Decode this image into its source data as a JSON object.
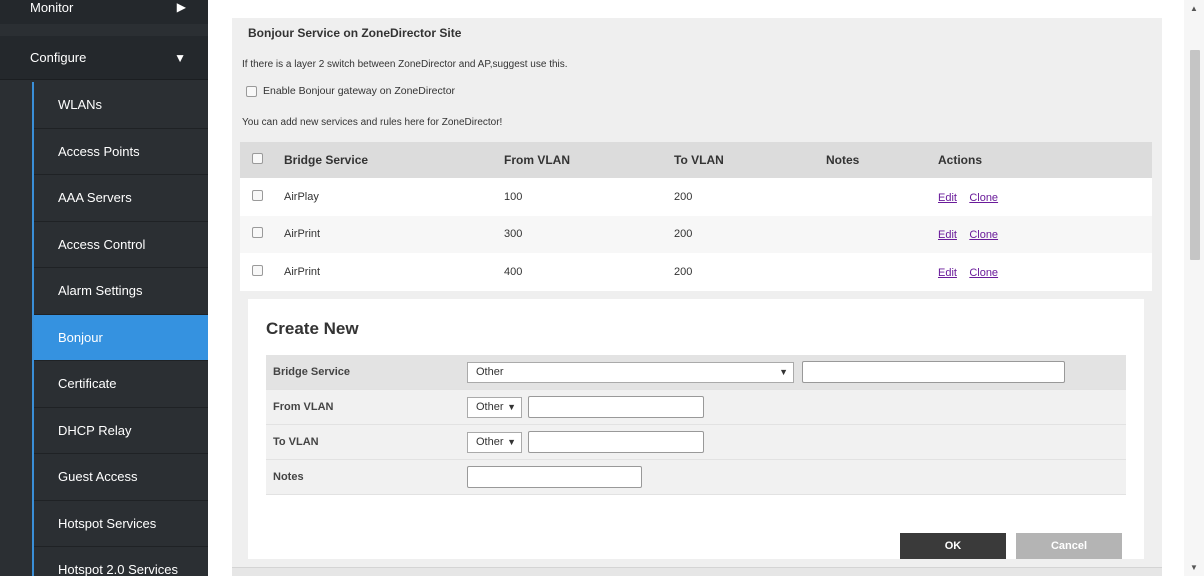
{
  "sidebar": {
    "monitor_label": "Monitor",
    "configure_label": "Configure",
    "items": [
      {
        "label": "WLANs"
      },
      {
        "label": "Access Points"
      },
      {
        "label": "AAA Servers"
      },
      {
        "label": "Access Control"
      },
      {
        "label": "Alarm Settings"
      },
      {
        "label": "Bonjour"
      },
      {
        "label": "Certificate"
      },
      {
        "label": "DHCP Relay"
      },
      {
        "label": "Guest Access"
      },
      {
        "label": "Hotspot Services"
      },
      {
        "label": "Hotspot 2.0 Services"
      }
    ],
    "active_item": "Bonjour"
  },
  "main": {
    "section_title": "Bonjour Service on ZoneDirector Site",
    "info_text": "If there is a layer 2 switch between ZoneDirector and AP,suggest use this.",
    "gateway_label": "Enable Bonjour gateway on ZoneDirector",
    "add_text": "You can add new services and rules here for ZoneDirector!",
    "table": {
      "headers": {
        "bridge_service": "Bridge Service",
        "from_vlan": "From VLAN",
        "to_vlan": "To VLAN",
        "notes": "Notes",
        "actions": "Actions"
      },
      "rows": [
        {
          "bridge_service": "AirPlay",
          "from_vlan": "100",
          "to_vlan": "200",
          "notes": "",
          "edit": "Edit",
          "clone": "Clone"
        },
        {
          "bridge_service": "AirPrint",
          "from_vlan": "300",
          "to_vlan": "200",
          "notes": "",
          "edit": "Edit",
          "clone": "Clone"
        },
        {
          "bridge_service": "AirPrint",
          "from_vlan": "400",
          "to_vlan": "200",
          "notes": "",
          "edit": "Edit",
          "clone": "Clone"
        }
      ]
    }
  },
  "create_new": {
    "title": "Create New",
    "bridge_service_label": "Bridge Service",
    "bridge_service_value": "Other",
    "from_vlan_label": "From VLAN",
    "from_vlan_value": "Other",
    "to_vlan_label": "To VLAN",
    "to_vlan_value": "Other",
    "notes_label": "Notes",
    "ok_label": "OK",
    "cancel_label": "Cancel"
  },
  "icons": {
    "monitor_arrow": "chevron-right-icon",
    "configure_arrow": "chevron-down-icon",
    "select_caret": "caret-down-icon"
  }
}
